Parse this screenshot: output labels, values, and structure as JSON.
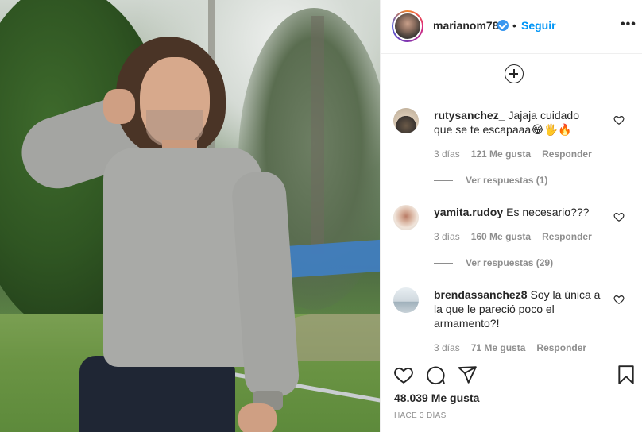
{
  "post": {
    "image_alt_subject": "",
    "header": {
      "username": "marianom78",
      "separator": "•",
      "follow_label": "Seguir",
      "more_label": "•••"
    },
    "comments": [
      {
        "user": "rutysanchez_",
        "text": "Jajaja cuidado que se te escapaaa😂🖐🔥",
        "time": "3 días",
        "likes": "121 Me gusta",
        "reply_label": "Responder",
        "view_replies": "Ver respuestas (1)"
      },
      {
        "user": "yamita.rudoy",
        "text": "Es necesario???",
        "time": "3 días",
        "likes": "160 Me gusta",
        "reply_label": "Responder",
        "view_replies": "Ver respuestas (29)"
      },
      {
        "user": "brendassanchez8",
        "text": "Soy la única a la que le pareció poco el armamento?!",
        "time": "3 días",
        "likes": "71 Me gusta",
        "reply_label": "Responder",
        "view_replies": ""
      }
    ],
    "footer": {
      "likes": "48.039 Me gusta",
      "time_ago": "HACE 3 DÍAS"
    }
  },
  "colors": {
    "link_blue": "#0095f6",
    "verified_blue": "#3897f0",
    "text": "#262626",
    "muted": "#8e8e8e"
  }
}
